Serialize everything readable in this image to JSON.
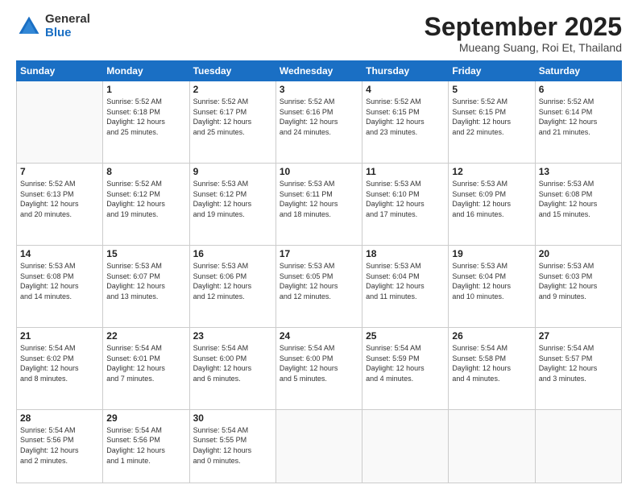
{
  "header": {
    "logo_general": "General",
    "logo_blue": "Blue",
    "month_title": "September 2025",
    "location": "Mueang Suang, Roi Et, Thailand"
  },
  "days_of_week": [
    "Sunday",
    "Monday",
    "Tuesday",
    "Wednesday",
    "Thursday",
    "Friday",
    "Saturday"
  ],
  "weeks": [
    [
      {
        "day": "",
        "text": ""
      },
      {
        "day": "1",
        "text": "Sunrise: 5:52 AM\nSunset: 6:18 PM\nDaylight: 12 hours\nand 25 minutes."
      },
      {
        "day": "2",
        "text": "Sunrise: 5:52 AM\nSunset: 6:17 PM\nDaylight: 12 hours\nand 25 minutes."
      },
      {
        "day": "3",
        "text": "Sunrise: 5:52 AM\nSunset: 6:16 PM\nDaylight: 12 hours\nand 24 minutes."
      },
      {
        "day": "4",
        "text": "Sunrise: 5:52 AM\nSunset: 6:15 PM\nDaylight: 12 hours\nand 23 minutes."
      },
      {
        "day": "5",
        "text": "Sunrise: 5:52 AM\nSunset: 6:15 PM\nDaylight: 12 hours\nand 22 minutes."
      },
      {
        "day": "6",
        "text": "Sunrise: 5:52 AM\nSunset: 6:14 PM\nDaylight: 12 hours\nand 21 minutes."
      }
    ],
    [
      {
        "day": "7",
        "text": "Sunrise: 5:52 AM\nSunset: 6:13 PM\nDaylight: 12 hours\nand 20 minutes."
      },
      {
        "day": "8",
        "text": "Sunrise: 5:52 AM\nSunset: 6:12 PM\nDaylight: 12 hours\nand 19 minutes."
      },
      {
        "day": "9",
        "text": "Sunrise: 5:53 AM\nSunset: 6:12 PM\nDaylight: 12 hours\nand 19 minutes."
      },
      {
        "day": "10",
        "text": "Sunrise: 5:53 AM\nSunset: 6:11 PM\nDaylight: 12 hours\nand 18 minutes."
      },
      {
        "day": "11",
        "text": "Sunrise: 5:53 AM\nSunset: 6:10 PM\nDaylight: 12 hours\nand 17 minutes."
      },
      {
        "day": "12",
        "text": "Sunrise: 5:53 AM\nSunset: 6:09 PM\nDaylight: 12 hours\nand 16 minutes."
      },
      {
        "day": "13",
        "text": "Sunrise: 5:53 AM\nSunset: 6:08 PM\nDaylight: 12 hours\nand 15 minutes."
      }
    ],
    [
      {
        "day": "14",
        "text": "Sunrise: 5:53 AM\nSunset: 6:08 PM\nDaylight: 12 hours\nand 14 minutes."
      },
      {
        "day": "15",
        "text": "Sunrise: 5:53 AM\nSunset: 6:07 PM\nDaylight: 12 hours\nand 13 minutes."
      },
      {
        "day": "16",
        "text": "Sunrise: 5:53 AM\nSunset: 6:06 PM\nDaylight: 12 hours\nand 12 minutes."
      },
      {
        "day": "17",
        "text": "Sunrise: 5:53 AM\nSunset: 6:05 PM\nDaylight: 12 hours\nand 12 minutes."
      },
      {
        "day": "18",
        "text": "Sunrise: 5:53 AM\nSunset: 6:04 PM\nDaylight: 12 hours\nand 11 minutes."
      },
      {
        "day": "19",
        "text": "Sunrise: 5:53 AM\nSunset: 6:04 PM\nDaylight: 12 hours\nand 10 minutes."
      },
      {
        "day": "20",
        "text": "Sunrise: 5:53 AM\nSunset: 6:03 PM\nDaylight: 12 hours\nand 9 minutes."
      }
    ],
    [
      {
        "day": "21",
        "text": "Sunrise: 5:54 AM\nSunset: 6:02 PM\nDaylight: 12 hours\nand 8 minutes."
      },
      {
        "day": "22",
        "text": "Sunrise: 5:54 AM\nSunset: 6:01 PM\nDaylight: 12 hours\nand 7 minutes."
      },
      {
        "day": "23",
        "text": "Sunrise: 5:54 AM\nSunset: 6:00 PM\nDaylight: 12 hours\nand 6 minutes."
      },
      {
        "day": "24",
        "text": "Sunrise: 5:54 AM\nSunset: 6:00 PM\nDaylight: 12 hours\nand 5 minutes."
      },
      {
        "day": "25",
        "text": "Sunrise: 5:54 AM\nSunset: 5:59 PM\nDaylight: 12 hours\nand 4 minutes."
      },
      {
        "day": "26",
        "text": "Sunrise: 5:54 AM\nSunset: 5:58 PM\nDaylight: 12 hours\nand 4 minutes."
      },
      {
        "day": "27",
        "text": "Sunrise: 5:54 AM\nSunset: 5:57 PM\nDaylight: 12 hours\nand 3 minutes."
      }
    ],
    [
      {
        "day": "28",
        "text": "Sunrise: 5:54 AM\nSunset: 5:56 PM\nDaylight: 12 hours\nand 2 minutes."
      },
      {
        "day": "29",
        "text": "Sunrise: 5:54 AM\nSunset: 5:56 PM\nDaylight: 12 hours\nand 1 minute."
      },
      {
        "day": "30",
        "text": "Sunrise: 5:54 AM\nSunset: 5:55 PM\nDaylight: 12 hours\nand 0 minutes."
      },
      {
        "day": "",
        "text": ""
      },
      {
        "day": "",
        "text": ""
      },
      {
        "day": "",
        "text": ""
      },
      {
        "day": "",
        "text": ""
      }
    ]
  ]
}
